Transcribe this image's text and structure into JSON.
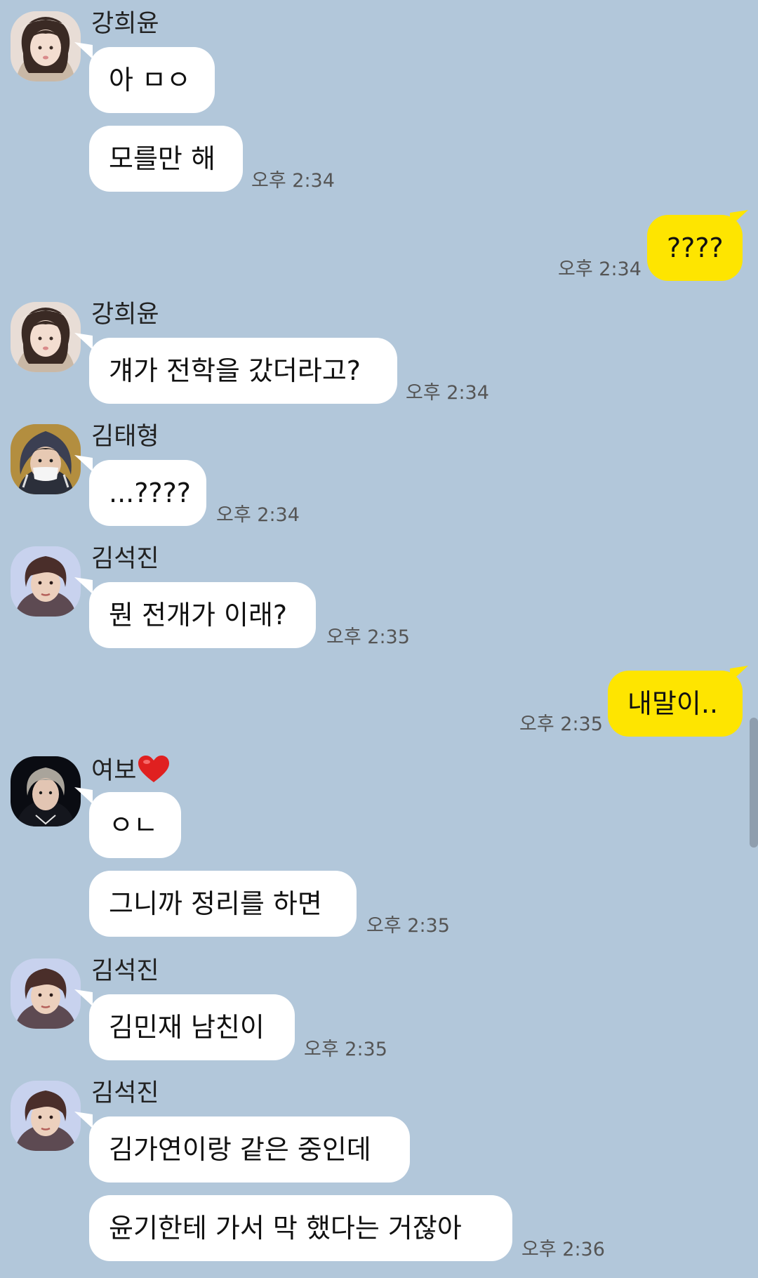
{
  "theme": {
    "background": "#b2c7da",
    "bubble_in": "#ffffff",
    "bubble_out": "#fee500",
    "heart": "#e02020"
  },
  "messages": [
    {
      "sender": "강희윤",
      "text": "아 ㅁㅇ"
    },
    {
      "text": "모를만 해",
      "time": "오후 2:34"
    },
    {
      "mine": true,
      "text": "????",
      "time": "오후 2:34"
    },
    {
      "sender": "강희윤",
      "text": "걔가 전학을 갔더라고?",
      "time": "오후 2:34"
    },
    {
      "sender": "김태형",
      "text": "...????",
      "time": "오후 2:34"
    },
    {
      "sender": "김석진",
      "text": "뭔 전개가 이래?",
      "time": "오후 2:35"
    },
    {
      "mine": true,
      "text": "내말이..",
      "time": "오후 2:35"
    },
    {
      "sender": "여보",
      "sender_icon": "heart-icon",
      "text": "ㅇㄴ"
    },
    {
      "text": "그니까 정리를 하면",
      "time": "오후 2:35"
    },
    {
      "sender": "김석진",
      "text": "김민재 남친이",
      "time": "오후 2:35"
    },
    {
      "sender": "김석진",
      "text": "김가연이랑 같은 중인데"
    },
    {
      "text": "윤기한테 가서 막 했다는 거잖아",
      "time": "오후 2:36"
    }
  ]
}
